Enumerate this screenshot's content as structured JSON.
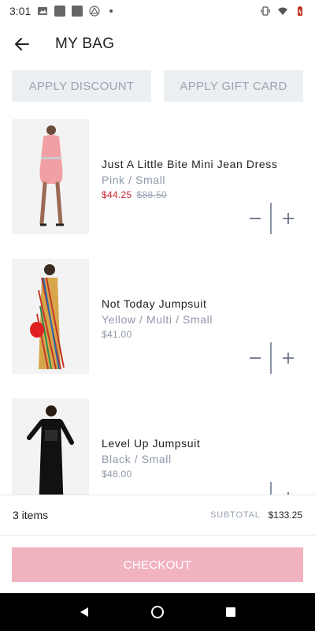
{
  "status_bar": {
    "time": "3:01"
  },
  "header": {
    "title": "MY BAG"
  },
  "promos": {
    "discount_label": "APPLY DISCOUNT",
    "gift_card_label": "APPLY GIFT CARD"
  },
  "items": [
    {
      "name": "Just A Little Bite Mini Jean Dress",
      "variant": "Pink / Small",
      "sale_price": "$44.25",
      "original_price": "$88.50",
      "image_color": "#f0a0a4"
    },
    {
      "name": "Not Today Jumpsuit",
      "variant": "Yellow / Multi / Small",
      "price": "$41.00",
      "image_color": "#d8a64a"
    },
    {
      "name": "Level Up Jumpsuit",
      "variant": "Black / Small",
      "price": "$48.00",
      "image_color": "#111111"
    }
  ],
  "summary": {
    "count": "3 items",
    "subtotal_label": "SUBTOTAL",
    "subtotal_value": "$133.25"
  },
  "checkout": {
    "label": "CHECKOUT"
  },
  "colors": {
    "accent_pink": "#f2b3c0",
    "sale_red": "#d0242f",
    "muted": "#8f98a8",
    "button_bg": "#eceff2"
  }
}
